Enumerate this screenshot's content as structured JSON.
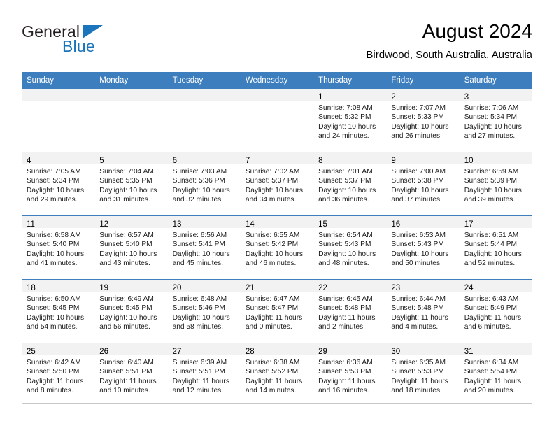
{
  "brand": {
    "name_part1": "General",
    "name_part2": "Blue",
    "icon": "triangle-logo",
    "accent_color": "#1b75bc"
  },
  "header": {
    "title": "August 2024",
    "subtitle": "Birdwood, South Australia, Australia"
  },
  "theme": {
    "header_bg": "#3d7ebf",
    "daynum_band_bg": "#f2f2f2",
    "text_color": "#000000"
  },
  "calendar": {
    "weekdays": [
      "Sunday",
      "Monday",
      "Tuesday",
      "Wednesday",
      "Thursday",
      "Friday",
      "Saturday"
    ],
    "weeks": [
      [
        {
          "day": "",
          "lines": []
        },
        {
          "day": "",
          "lines": []
        },
        {
          "day": "",
          "lines": []
        },
        {
          "day": "",
          "lines": []
        },
        {
          "day": "1",
          "lines": [
            "Sunrise: 7:08 AM",
            "Sunset: 5:32 PM",
            "Daylight: 10 hours",
            "and 24 minutes."
          ]
        },
        {
          "day": "2",
          "lines": [
            "Sunrise: 7:07 AM",
            "Sunset: 5:33 PM",
            "Daylight: 10 hours",
            "and 26 minutes."
          ]
        },
        {
          "day": "3",
          "lines": [
            "Sunrise: 7:06 AM",
            "Sunset: 5:34 PM",
            "Daylight: 10 hours",
            "and 27 minutes."
          ]
        }
      ],
      [
        {
          "day": "4",
          "lines": [
            "Sunrise: 7:05 AM",
            "Sunset: 5:34 PM",
            "Daylight: 10 hours",
            "and 29 minutes."
          ]
        },
        {
          "day": "5",
          "lines": [
            "Sunrise: 7:04 AM",
            "Sunset: 5:35 PM",
            "Daylight: 10 hours",
            "and 31 minutes."
          ]
        },
        {
          "day": "6",
          "lines": [
            "Sunrise: 7:03 AM",
            "Sunset: 5:36 PM",
            "Daylight: 10 hours",
            "and 32 minutes."
          ]
        },
        {
          "day": "7",
          "lines": [
            "Sunrise: 7:02 AM",
            "Sunset: 5:37 PM",
            "Daylight: 10 hours",
            "and 34 minutes."
          ]
        },
        {
          "day": "8",
          "lines": [
            "Sunrise: 7:01 AM",
            "Sunset: 5:37 PM",
            "Daylight: 10 hours",
            "and 36 minutes."
          ]
        },
        {
          "day": "9",
          "lines": [
            "Sunrise: 7:00 AM",
            "Sunset: 5:38 PM",
            "Daylight: 10 hours",
            "and 37 minutes."
          ]
        },
        {
          "day": "10",
          "lines": [
            "Sunrise: 6:59 AM",
            "Sunset: 5:39 PM",
            "Daylight: 10 hours",
            "and 39 minutes."
          ]
        }
      ],
      [
        {
          "day": "11",
          "lines": [
            "Sunrise: 6:58 AM",
            "Sunset: 5:40 PM",
            "Daylight: 10 hours",
            "and 41 minutes."
          ]
        },
        {
          "day": "12",
          "lines": [
            "Sunrise: 6:57 AM",
            "Sunset: 5:40 PM",
            "Daylight: 10 hours",
            "and 43 minutes."
          ]
        },
        {
          "day": "13",
          "lines": [
            "Sunrise: 6:56 AM",
            "Sunset: 5:41 PM",
            "Daylight: 10 hours",
            "and 45 minutes."
          ]
        },
        {
          "day": "14",
          "lines": [
            "Sunrise: 6:55 AM",
            "Sunset: 5:42 PM",
            "Daylight: 10 hours",
            "and 46 minutes."
          ]
        },
        {
          "day": "15",
          "lines": [
            "Sunrise: 6:54 AM",
            "Sunset: 5:43 PM",
            "Daylight: 10 hours",
            "and 48 minutes."
          ]
        },
        {
          "day": "16",
          "lines": [
            "Sunrise: 6:53 AM",
            "Sunset: 5:43 PM",
            "Daylight: 10 hours",
            "and 50 minutes."
          ]
        },
        {
          "day": "17",
          "lines": [
            "Sunrise: 6:51 AM",
            "Sunset: 5:44 PM",
            "Daylight: 10 hours",
            "and 52 minutes."
          ]
        }
      ],
      [
        {
          "day": "18",
          "lines": [
            "Sunrise: 6:50 AM",
            "Sunset: 5:45 PM",
            "Daylight: 10 hours",
            "and 54 minutes."
          ]
        },
        {
          "day": "19",
          "lines": [
            "Sunrise: 6:49 AM",
            "Sunset: 5:45 PM",
            "Daylight: 10 hours",
            "and 56 minutes."
          ]
        },
        {
          "day": "20",
          "lines": [
            "Sunrise: 6:48 AM",
            "Sunset: 5:46 PM",
            "Daylight: 10 hours",
            "and 58 minutes."
          ]
        },
        {
          "day": "21",
          "lines": [
            "Sunrise: 6:47 AM",
            "Sunset: 5:47 PM",
            "Daylight: 11 hours",
            "and 0 minutes."
          ]
        },
        {
          "day": "22",
          "lines": [
            "Sunrise: 6:45 AM",
            "Sunset: 5:48 PM",
            "Daylight: 11 hours",
            "and 2 minutes."
          ]
        },
        {
          "day": "23",
          "lines": [
            "Sunrise: 6:44 AM",
            "Sunset: 5:48 PM",
            "Daylight: 11 hours",
            "and 4 minutes."
          ]
        },
        {
          "day": "24",
          "lines": [
            "Sunrise: 6:43 AM",
            "Sunset: 5:49 PM",
            "Daylight: 11 hours",
            "and 6 minutes."
          ]
        }
      ],
      [
        {
          "day": "25",
          "lines": [
            "Sunrise: 6:42 AM",
            "Sunset: 5:50 PM",
            "Daylight: 11 hours",
            "and 8 minutes."
          ]
        },
        {
          "day": "26",
          "lines": [
            "Sunrise: 6:40 AM",
            "Sunset: 5:51 PM",
            "Daylight: 11 hours",
            "and 10 minutes."
          ]
        },
        {
          "day": "27",
          "lines": [
            "Sunrise: 6:39 AM",
            "Sunset: 5:51 PM",
            "Daylight: 11 hours",
            "and 12 minutes."
          ]
        },
        {
          "day": "28",
          "lines": [
            "Sunrise: 6:38 AM",
            "Sunset: 5:52 PM",
            "Daylight: 11 hours",
            "and 14 minutes."
          ]
        },
        {
          "day": "29",
          "lines": [
            "Sunrise: 6:36 AM",
            "Sunset: 5:53 PM",
            "Daylight: 11 hours",
            "and 16 minutes."
          ]
        },
        {
          "day": "30",
          "lines": [
            "Sunrise: 6:35 AM",
            "Sunset: 5:53 PM",
            "Daylight: 11 hours",
            "and 18 minutes."
          ]
        },
        {
          "day": "31",
          "lines": [
            "Sunrise: 6:34 AM",
            "Sunset: 5:54 PM",
            "Daylight: 11 hours",
            "and 20 minutes."
          ]
        }
      ]
    ]
  }
}
